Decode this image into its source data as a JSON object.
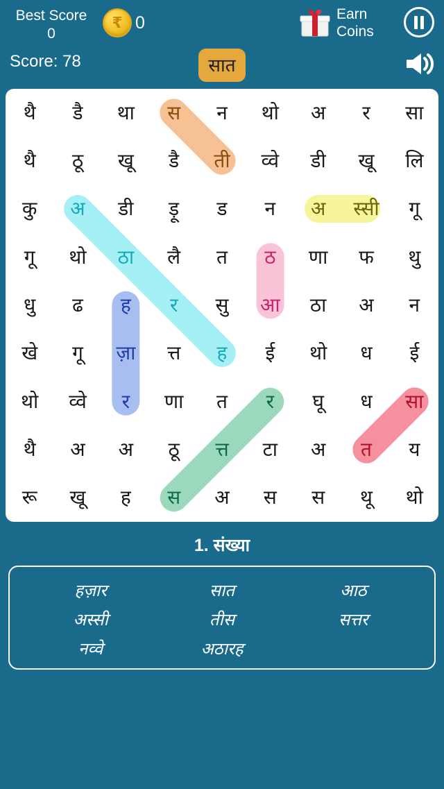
{
  "header": {
    "best_score_label": "Best Score",
    "best_score_value": "0",
    "coin_icon": "rupee-coin-icon",
    "coin_count": "0",
    "earn_coins_line1": "Earn",
    "earn_coins_line2": "Coins",
    "gift_icon": "gift-box-icon",
    "pause_icon": "pause-icon",
    "sound_icon": "speaker-icon",
    "score_label": "Score: 78",
    "current_word": "सात"
  },
  "colors": {
    "background": "#1a6a8c",
    "grid_card": "#ffffff",
    "badge": "#e5a83c",
    "highlight_orange": "#f7c293",
    "highlight_cyan": "#a5f0f5",
    "highlight_yellow": "#f7f59a",
    "highlight_pink": "#f9c3d8",
    "highlight_blue": "#a8bdf0",
    "highlight_green": "#9ad9bb",
    "highlight_red": "#f6909f"
  },
  "grid": {
    "rows": 9,
    "cols": 9,
    "letters": [
      [
        "थै",
        "डै",
        "था",
        "स",
        "न",
        "थो",
        "अ",
        "र",
        "सा"
      ],
      [
        "थै",
        "ठू",
        "खू",
        "डै",
        "ती",
        "व्वे",
        "डी",
        "खू",
        "लि"
      ],
      [
        "कु",
        "अ",
        "डी",
        "ड़ू",
        "ड",
        "न",
        "अ",
        "स्सी",
        "गू"
      ],
      [
        "गू",
        "थो",
        "ठा",
        "लै",
        "त",
        "ठ",
        "णा",
        "फ",
        "थु"
      ],
      [
        "धु",
        "ढ",
        "ह",
        "र",
        "सु",
        "आ",
        "ठा",
        "अ",
        "न"
      ],
      [
        "खे",
        "गू",
        "ज़ा",
        "त्त",
        "ह",
        "ई",
        "थो",
        "ध",
        "ई"
      ],
      [
        "थो",
        "व्वे",
        "र",
        "णा",
        "त",
        "र",
        "घू",
        "ध",
        "सा"
      ],
      [
        "थै",
        "अ",
        "अ",
        "ठू",
        "त्त",
        "टा",
        "अ",
        "त",
        "य"
      ],
      [
        "रू",
        "खू",
        "ह",
        "स",
        "अ",
        "स",
        "स",
        "थू",
        "थो"
      ]
    ]
  },
  "found_words": [
    {
      "word": "तीस",
      "color": "highlight_orange",
      "text_class": "lit-orange",
      "cells": [
        [
          0,
          3
        ],
        [
          1,
          4
        ]
      ]
    },
    {
      "word": "अठारह",
      "color": "highlight_cyan",
      "text_class": "lit-cyan",
      "cells": [
        [
          2,
          1
        ],
        [
          3,
          2
        ],
        [
          4,
          3
        ],
        [
          5,
          4
        ]
      ]
    },
    {
      "word": "अस्सी",
      "color": "highlight_yellow",
      "text_class": "lit-olive",
      "cells": [
        [
          2,
          6
        ],
        [
          2,
          7
        ]
      ]
    },
    {
      "word": "आठ",
      "color": "highlight_pink",
      "text_class": "lit-pink",
      "cells": [
        [
          3,
          5
        ],
        [
          4,
          5
        ]
      ]
    },
    {
      "word": "हज़ार",
      "color": "highlight_blue",
      "text_class": "lit-blue",
      "cells": [
        [
          4,
          2
        ],
        [
          5,
          2
        ],
        [
          6,
          2
        ]
      ]
    },
    {
      "word": "सत्तर",
      "color": "highlight_green",
      "text_class": "lit-green",
      "cells": [
        [
          8,
          3
        ],
        [
          7,
          4
        ],
        [
          6,
          5
        ]
      ]
    },
    {
      "word": "सात",
      "color": "highlight_red",
      "text_class": "lit-red",
      "cells": [
        [
          7,
          7
        ],
        [
          6,
          8
        ]
      ]
    }
  ],
  "word_list": {
    "category": "1. संख्या",
    "words": [
      "हज़ार",
      "अस्सी",
      "नव्वे",
      "सात",
      "तीस",
      "अठारह",
      "आठ",
      "सत्तर",
      ""
    ]
  }
}
